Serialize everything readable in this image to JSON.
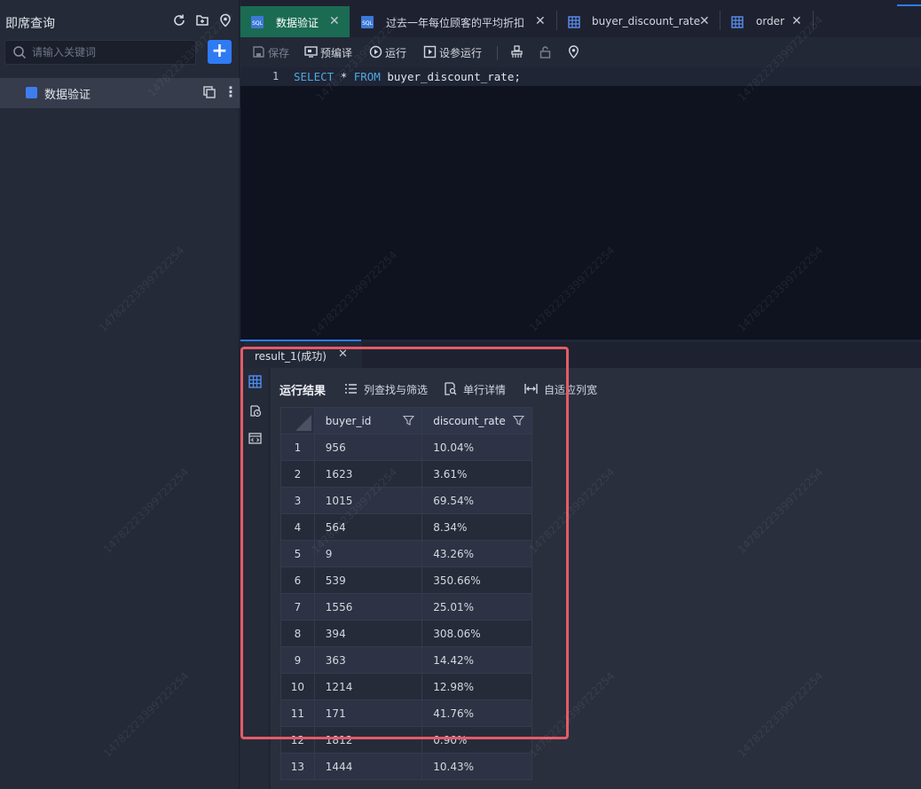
{
  "sidebar": {
    "title": "即席查询",
    "search_placeholder": "请输入关键词",
    "add_label": "+",
    "tree": [
      {
        "label": "数据验证"
      }
    ]
  },
  "tabs": [
    {
      "label": "数据验证",
      "icon": "sql-file-icon",
      "active": true
    },
    {
      "label": "过去一年每位顾客的平均折扣",
      "icon": "sql-file-icon",
      "active": false
    },
    {
      "label": "buyer_discount_rate",
      "icon": "table-icon",
      "active": false
    },
    {
      "label": "order",
      "icon": "table-icon",
      "active": false
    }
  ],
  "toolbar": {
    "save": "保存",
    "precompile": "预编译",
    "run": "运行",
    "run_with_params": "设参运行"
  },
  "editor": {
    "line_number": "1",
    "code": {
      "kw_select": "SELECT",
      "star": " * ",
      "kw_from": "FROM",
      "rest": " buyer_discount_rate;"
    }
  },
  "result": {
    "tab_label": "result_1(成功)",
    "title": "运行结果",
    "actions": {
      "filter": "列查找与筛选",
      "row_detail": "单行详情",
      "autofit": "自适应列宽"
    },
    "columns": [
      "buyer_id",
      "discount_rate"
    ],
    "rows": [
      [
        "1",
        "956",
        "10.04%"
      ],
      [
        "2",
        "1623",
        "3.61%"
      ],
      [
        "3",
        "1015",
        "69.54%"
      ],
      [
        "4",
        "564",
        "8.34%"
      ],
      [
        "5",
        "9",
        "43.26%"
      ],
      [
        "6",
        "539",
        "350.66%"
      ],
      [
        "7",
        "1556",
        "25.01%"
      ],
      [
        "8",
        "394",
        "308.06%"
      ],
      [
        "9",
        "363",
        "14.42%"
      ],
      [
        "10",
        "1214",
        "12.98%"
      ],
      [
        "11",
        "171",
        "41.76%"
      ],
      [
        "12",
        "1812",
        "0.90%"
      ],
      [
        "13",
        "1444",
        "10.43%"
      ]
    ]
  },
  "watermark": "14782223399722254",
  "colors": {
    "accent": "#2f7bf5",
    "active_tab": "#1b6b53",
    "highlight": "#e45b68",
    "keyword": "#4fa8e0"
  }
}
